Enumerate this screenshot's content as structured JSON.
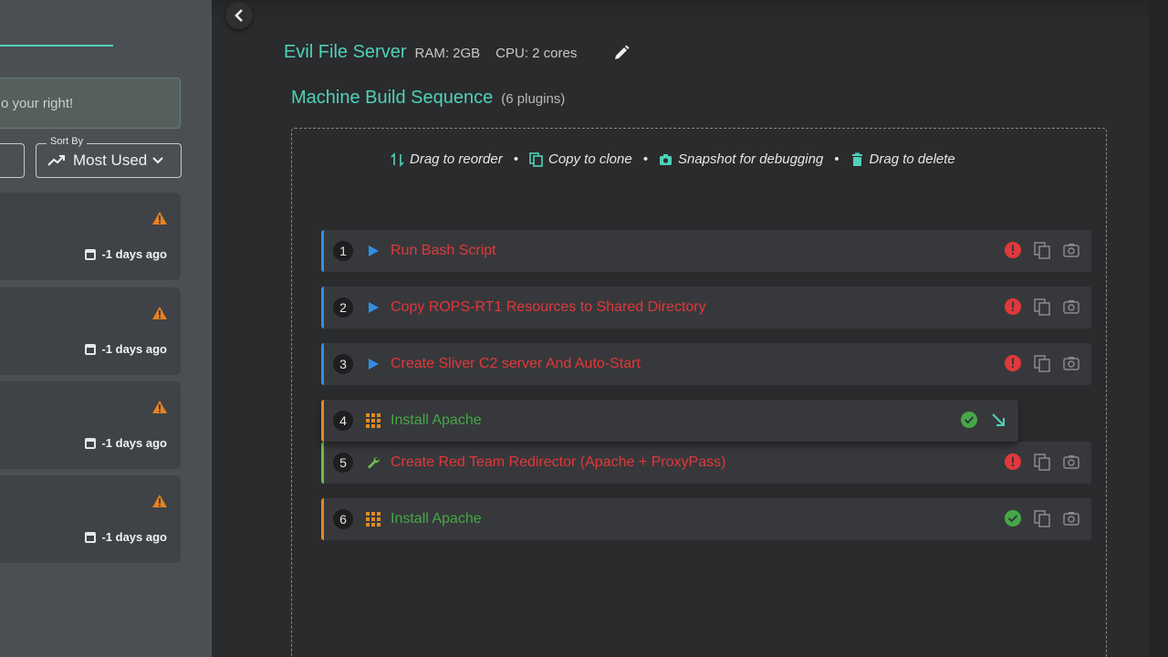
{
  "left_panel": {
    "hint_text": "o your right!",
    "sort": {
      "label": "Sort By",
      "value": "Most Used"
    },
    "cards": [
      {
        "time": "-1 days ago"
      },
      {
        "time": "-1 days ago"
      },
      {
        "time": "-1 days ago"
      },
      {
        "time": "-1 days ago"
      }
    ]
  },
  "machine": {
    "name": "Evil File Server",
    "ram": "RAM: 2GB",
    "cpu": "CPU: 2 cores"
  },
  "sequence": {
    "title": "Machine Build Sequence",
    "count": "(6 plugins)",
    "legend": {
      "reorder": "Drag to reorder",
      "clone": "Copy to clone",
      "snapshot": "Snapshot for debugging",
      "delete": "Drag to delete"
    },
    "plugins": [
      {
        "num": "1",
        "name": "Run Bash Script",
        "status": "error",
        "type": "play"
      },
      {
        "num": "2",
        "name": "Copy ROPS-RT1 Resources to Shared Directory",
        "status": "error",
        "type": "play"
      },
      {
        "num": "3",
        "name": "Create Sliver C2 server And Auto-Start",
        "status": "error",
        "type": "play"
      },
      {
        "num": "4",
        "name": "Install Apache",
        "status": "ok",
        "type": "grid"
      },
      {
        "num": "5",
        "name": "Create Red Team Redirector (Apache + ProxyPass)",
        "status": "error",
        "type": "wrench"
      },
      {
        "num": "6",
        "name": "Install Apache",
        "status": "ok",
        "type": "grid"
      }
    ]
  },
  "colors": {
    "accent": "#4fd1b8",
    "error": "#e0383b",
    "success": "#45a848",
    "play": "#2f8fe8",
    "grid": "#e38a1e",
    "wrench": "#6fbe4a"
  }
}
